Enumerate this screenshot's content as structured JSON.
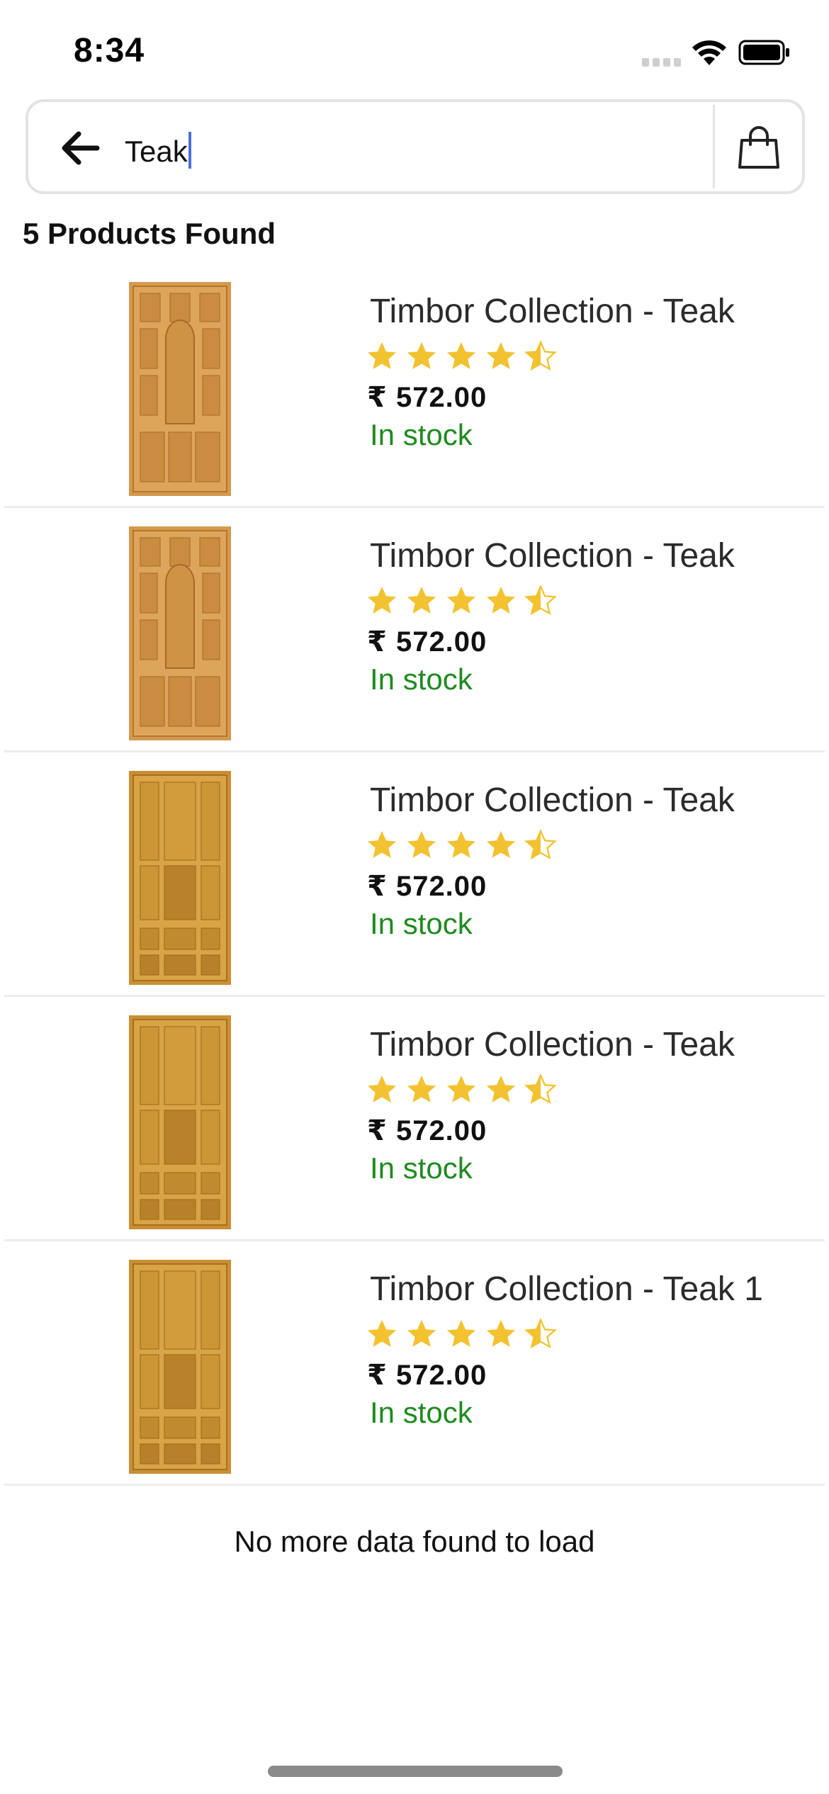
{
  "status_bar": {
    "time": "8:34"
  },
  "search": {
    "query": "Teak"
  },
  "results": {
    "count_label": "5 Products Found"
  },
  "products": [
    {
      "name": "Timbor Collection - Teak",
      "rating": 4.5,
      "price": "₹ 572.00",
      "stock": "In stock",
      "image": "door-arched-panel"
    },
    {
      "name": "Timbor Collection - Teak",
      "rating": 4.5,
      "price": "₹ 572.00",
      "stock": "In stock",
      "image": "door-arched-panel"
    },
    {
      "name": "Timbor Collection - Teak",
      "rating": 4.5,
      "price": "₹ 572.00",
      "stock": "In stock",
      "image": "door-raised-panel"
    },
    {
      "name": "Timbor Collection - Teak",
      "rating": 4.5,
      "price": "₹ 572.00",
      "stock": "In stock",
      "image": "door-raised-panel"
    },
    {
      "name": "Timbor Collection - Teak 1",
      "rating": 4.5,
      "price": "₹ 572.00",
      "stock": "In stock",
      "image": "door-raised-panel"
    }
  ],
  "footer": {
    "message": "No more data found to load"
  },
  "colors": {
    "star": "#f2c230",
    "in_stock": "#1f8a1f",
    "caret": "#4a6ee0",
    "wood_light": "#d9a253",
    "wood_dark": "#b8762a"
  }
}
